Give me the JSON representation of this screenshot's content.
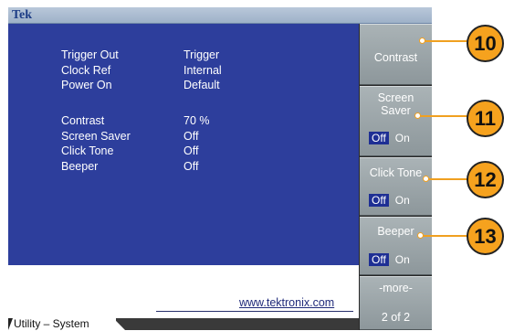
{
  "header": {
    "brand": "Tek"
  },
  "settings": [
    {
      "label": "Trigger Out",
      "value": "Trigger"
    },
    {
      "label": "Clock Ref",
      "value": "Internal"
    },
    {
      "label": "Power On",
      "value": "Default"
    },
    {
      "label": "Contrast",
      "value": "70 %"
    },
    {
      "label": "Screen Saver",
      "value": "Off"
    },
    {
      "label": "Click Tone",
      "value": "Off"
    },
    {
      "label": "Beeper",
      "value": "Off"
    }
  ],
  "footer": {
    "url": "www.tektronix.com",
    "tab_label": "Utility – System"
  },
  "softkeys": {
    "contrast": {
      "label": "Contrast"
    },
    "screen_saver": {
      "label_line1": "Screen",
      "label_line2": "Saver",
      "opt_off": "Off",
      "opt_on": "On"
    },
    "click_tone": {
      "label": "Click Tone",
      "opt_off": "Off",
      "opt_on": "On"
    },
    "beeper": {
      "label": "Beeper",
      "opt_off": "Off",
      "opt_on": "On"
    },
    "more": {
      "label": "-more-",
      "page": "2 of 2"
    }
  },
  "callouts": [
    "10",
    "11",
    "12",
    "13"
  ],
  "colors": {
    "panel": "#2d3e9c",
    "callout": "#f6a21e",
    "selected_option": "#1e2f94"
  }
}
